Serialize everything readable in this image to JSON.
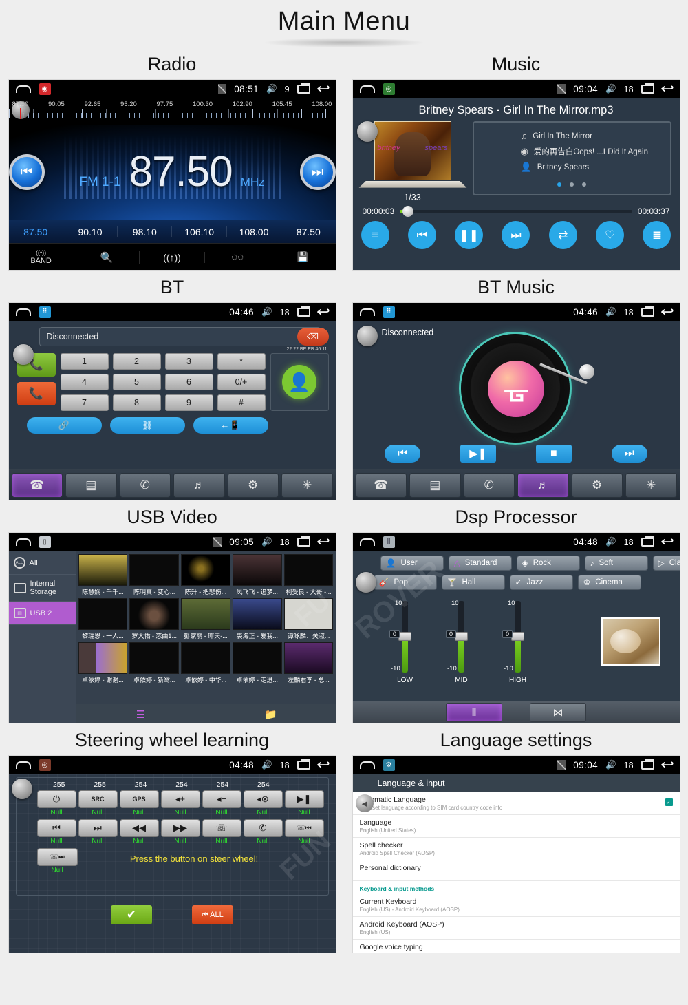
{
  "page": {
    "title": "Main Menu"
  },
  "sections": [
    {
      "label": "Radio"
    },
    {
      "label": "Music"
    },
    {
      "label": "BT"
    },
    {
      "label": "BT Music"
    },
    {
      "label": "USB Video"
    },
    {
      "label": "Dsp Processor"
    },
    {
      "label": "Steering wheel learning"
    },
    {
      "label": "Language settings"
    }
  ],
  "radio": {
    "status": {
      "time": "08:51",
      "volume": "9",
      "app_icon": "radio-icon"
    },
    "scale_labels": [
      "87.50",
      "90.05",
      "92.65",
      "95.20",
      "97.75",
      "100.30",
      "102.90",
      "105.45",
      "108.00"
    ],
    "band": "FM 1-1",
    "frequency": "87.50",
    "unit": "MHz",
    "presets": [
      "87.50",
      "90.10",
      "98.10",
      "106.10",
      "108.00",
      "87.50"
    ],
    "active_preset_index": 0,
    "tabs": [
      {
        "label": "BAND",
        "icon": "band-icon"
      },
      {
        "label": "",
        "icon": "scan-search-icon"
      },
      {
        "label": "",
        "icon": "antenna-icon"
      },
      {
        "label": "",
        "icon": "stereo-icon"
      },
      {
        "label": "",
        "icon": "save-icon"
      }
    ]
  },
  "music": {
    "status": {
      "time": "09:04",
      "volume": "18",
      "app_icon": "music-disc-icon"
    },
    "song_title": "Britney Spears - Girl In The Mirror.mp3",
    "album_text_left": "britney",
    "album_text_right": "spears",
    "track_counter": "1/33",
    "info": [
      {
        "icon": "note-icon",
        "text": "Girl In The Mirror"
      },
      {
        "icon": "disc-icon",
        "text": "爱的再告白Oops!  ...I Did It Again"
      },
      {
        "icon": "person-icon",
        "text": "Britney Spears"
      }
    ],
    "dots_total": 3,
    "dots_active": 0,
    "elapsed": "00:00:03",
    "duration": "00:03:37",
    "progress_percent": 1.4,
    "controls": [
      {
        "name": "equalizer-button",
        "glyph": "☰"
      },
      {
        "name": "previous-button",
        "glyph": "⏮"
      },
      {
        "name": "pause-button",
        "glyph": "⏸"
      },
      {
        "name": "next-button",
        "glyph": "⏭"
      },
      {
        "name": "repeat-button",
        "glyph": "↻"
      },
      {
        "name": "favorite-button",
        "glyph": "♡"
      },
      {
        "name": "playlist-button",
        "glyph": "≡"
      }
    ]
  },
  "bt": {
    "status": {
      "time": "04:46",
      "volume": "18",
      "app_icon": "phone-keypad-icon"
    },
    "connection_status": "Disconnected",
    "mac_address": "22:22:BE:EB:46:11",
    "keys": [
      "1",
      "2",
      "3",
      "*",
      "4",
      "5",
      "6",
      "0/+",
      "7",
      "8",
      "9",
      "#"
    ],
    "call_buttons": [
      {
        "name": "answer-call-button",
        "glyph": "☎"
      },
      {
        "name": "end-call-button",
        "glyph": "☎"
      }
    ],
    "action_buttons": [
      {
        "name": "connect-button",
        "glyph": "⚭"
      },
      {
        "name": "disconnect-button",
        "glyph": "⚭"
      },
      {
        "name": "transfer-audio-button",
        "glyph": "←☐"
      }
    ],
    "tabs": [
      {
        "name": "tab-dialpad",
        "glyph": "☎",
        "active": true
      },
      {
        "name": "tab-contacts",
        "glyph": "▤",
        "active": false
      },
      {
        "name": "tab-call-log",
        "glyph": "✆",
        "active": false
      },
      {
        "name": "tab-bt-music",
        "glyph": "♫",
        "active": false
      },
      {
        "name": "tab-settings",
        "glyph": "⚙",
        "active": false
      },
      {
        "name": "tab-bluetooth",
        "glyph": "ᛗ",
        "active": false
      }
    ]
  },
  "btmusic": {
    "status": {
      "time": "04:46",
      "volume": "18",
      "app_icon": "phone-keypad-icon"
    },
    "connection_status": "Disconnected",
    "center_icon": "bluetooth-icon",
    "controls": [
      {
        "name": "previous-button",
        "glyph": "⏮"
      },
      {
        "name": "play-pause-button",
        "glyph": "▶❙❙"
      },
      {
        "name": "stop-button",
        "glyph": "■"
      },
      {
        "name": "next-button",
        "glyph": "⏭"
      }
    ],
    "tabs": [
      {
        "name": "tab-dialpad",
        "glyph": "☎",
        "active": false
      },
      {
        "name": "tab-contacts",
        "glyph": "▤",
        "active": false
      },
      {
        "name": "tab-call-log",
        "glyph": "✆",
        "active": false
      },
      {
        "name": "tab-bt-music",
        "glyph": "♫",
        "active": true
      },
      {
        "name": "tab-settings",
        "glyph": "⚙",
        "active": false
      },
      {
        "name": "tab-bluetooth",
        "glyph": "ᛗ",
        "active": false
      }
    ]
  },
  "usbvideo": {
    "status": {
      "time": "09:05",
      "volume": "18",
      "app_icon": "usb-icon"
    },
    "sources": [
      {
        "label": "All",
        "icon": "all-icon",
        "active": false
      },
      {
        "label": "Internal Storage",
        "icon": "internal-storage-icon",
        "active": false
      },
      {
        "label": "USB 2",
        "icon": "usb-drive-icon",
        "active": true
      }
    ],
    "files": [
      [
        "陈慧娴 - 千千...",
        "陈明真 - 变心...",
        "陈升 - 把悲伤...",
        "凤飞飞 - 追梦...",
        "柯受良 - 大哥 -..."
      ],
      [
        "黎瑞恩 - 一人...",
        "罗大佑 - 恋曲1...",
        "彭家丽 - 昨天-...",
        "裘海正 - 爱我...",
        "谭咏麟、关淑..."
      ],
      [
        "卓依婷 - 谢谢...",
        "卓依婷 - 新鸳...",
        "卓依婷 - 中华...",
        "卓依婷 - 走进...",
        "左麟右李 - 总..."
      ]
    ],
    "bottom_tabs": [
      {
        "name": "list-view-button",
        "glyph": "≣",
        "active": true
      },
      {
        "name": "folder-view-button",
        "glyph": "Ὄ1",
        "active": false
      }
    ]
  },
  "dsp": {
    "status": {
      "time": "04:48",
      "volume": "18",
      "app_icon": "equalizer-icon"
    },
    "presets": [
      {
        "label": "User",
        "icon": "user-icon"
      },
      {
        "label": "Standard",
        "icon": "triangle-icon"
      },
      {
        "label": "Rock",
        "icon": "diamond-icon"
      },
      {
        "label": "Soft",
        "icon": "note-icon"
      },
      {
        "label": "Classic",
        "icon": "harp-icon"
      },
      {
        "label": "Pop",
        "icon": "guitar-icon"
      },
      {
        "label": "Hall",
        "icon": "cocktail-icon"
      },
      {
        "label": "Jazz",
        "icon": "sax-icon"
      },
      {
        "label": "Cinema",
        "icon": "crown-icon"
      }
    ],
    "active_preset": "Standard",
    "sliders": [
      {
        "label": "LOW",
        "value": "0",
        "max": "10",
        "min": "-10"
      },
      {
        "label": "MID",
        "value": "0",
        "max": "10",
        "min": "-10"
      },
      {
        "label": "HIGH",
        "value": "0",
        "max": "10",
        "min": "-10"
      }
    ],
    "tabs": [
      {
        "name": "equalizer-tab",
        "glyph": "☷",
        "active": true
      },
      {
        "name": "balance-tab",
        "glyph": "⋈",
        "active": false
      }
    ]
  },
  "steering": {
    "status": {
      "time": "04:48",
      "volume": "18",
      "app_icon": "steering-wheel-icon"
    },
    "values": [
      "255",
      "255",
      "254",
      "254",
      "254",
      "254"
    ],
    "keys_row1": [
      {
        "name": "power-key",
        "glyph": "⏻",
        "state": "Null"
      },
      {
        "name": "source-key",
        "glyph": "SRC",
        "state": "Null"
      },
      {
        "name": "gps-key",
        "glyph": "GPS",
        "state": "Null"
      },
      {
        "name": "volume-up-key",
        "glyph": "◂+",
        "state": "Null"
      },
      {
        "name": "volume-down-key",
        "glyph": "◂−",
        "state": "Null"
      },
      {
        "name": "mute-key",
        "glyph": "◂⊗",
        "state": "Null"
      },
      {
        "name": "play-pause-key",
        "glyph": "▶❙",
        "state": "Null"
      }
    ],
    "keys_row2": [
      {
        "name": "previous-track-key",
        "glyph": "⏮",
        "state": "Null"
      },
      {
        "name": "next-track-key",
        "glyph": "⏭",
        "state": "Null"
      },
      {
        "name": "rewind-key",
        "glyph": "◀◀",
        "state": "Null"
      },
      {
        "name": "fast-forward-key",
        "glyph": "▶▶",
        "state": "Null"
      },
      {
        "name": "answer-key",
        "glyph": "☎",
        "state": "Null"
      },
      {
        "name": "hangup-key",
        "glyph": "✆",
        "state": "Null"
      },
      {
        "name": "call-back-key",
        "glyph": "☎⏮",
        "state": "Null"
      }
    ],
    "keys_row3": [
      {
        "name": "voice-next-key",
        "glyph": "☎⏭",
        "state": "Null"
      }
    ],
    "message": "Press the button on steer wheel!",
    "confirm_label": "✔",
    "clear_all_label": "ALL"
  },
  "language": {
    "status": {
      "time": "09:04",
      "volume": "18",
      "app_icon": "settings-gear-icon"
    },
    "header": "Language & input",
    "items": [
      {
        "title": "Automatic Language",
        "subtitle": "Auto set language according to SIM card country code info",
        "checked": true
      },
      {
        "title": "Language",
        "subtitle": "English (United States)",
        "checked": false
      },
      {
        "title": "Spell checker",
        "subtitle": "Android Spell Checker (AOSP)",
        "checked": false
      },
      {
        "title": "Personal dictionary",
        "subtitle": "",
        "checked": false
      }
    ],
    "section_label": "Keyboard & input methods",
    "items2": [
      {
        "title": "Current Keyboard",
        "subtitle": "English (US) - Android Keyboard (AOSP)",
        "checked": false
      },
      {
        "title": "Android Keyboard (AOSP)",
        "subtitle": "English (US)",
        "checked": false
      },
      {
        "title": "Google voice typing",
        "subtitle": "",
        "checked": false
      }
    ]
  },
  "colors": {
    "page_bg": "#eeeeee",
    "accent_blue": "#29a9e8",
    "accent_purple": "#b05ccf",
    "accent_green": "#7ed321",
    "teal": "#089a8e"
  }
}
